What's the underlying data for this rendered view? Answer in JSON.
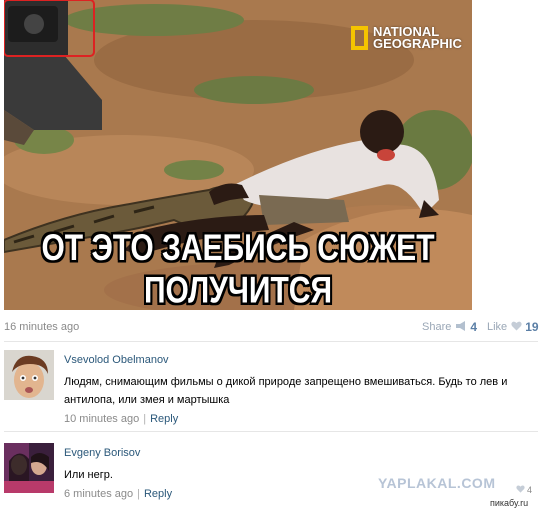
{
  "post": {
    "caption": "ОТ ЭТО ЗАЕБИСЬ СЮЖЕТ ПОЛУЧИТСЯ",
    "logo_line1": "NATIONAL",
    "logo_line2": "GEOGRAPHIC",
    "time": "16 minutes ago",
    "share_label": "Share",
    "share_count": "4",
    "like_label": "Like",
    "like_count": "19"
  },
  "comments": [
    {
      "author": "Vsevolod Obelmanov",
      "text": "Людям, снимающим фильмы о дикой природе запрещено вмешиваться. Будь то лев и антилопа, или змея и мартышка",
      "time": "10 minutes ago",
      "reply_label": "Reply"
    },
    {
      "author": "Evgeny Borisov",
      "text": "Или негр.",
      "time": "6 minutes ago",
      "reply_label": "Reply",
      "like_count": "4"
    }
  ],
  "watermarks": {
    "yaplakal": "YAPLAKAL.COM",
    "pikabu": "пикабу.ru"
  },
  "colors": {
    "link": "#2b587a",
    "muted": "#8a8a8a",
    "accent_count": "#5b7fa6",
    "natgeo_yellow": "#f5c400"
  }
}
